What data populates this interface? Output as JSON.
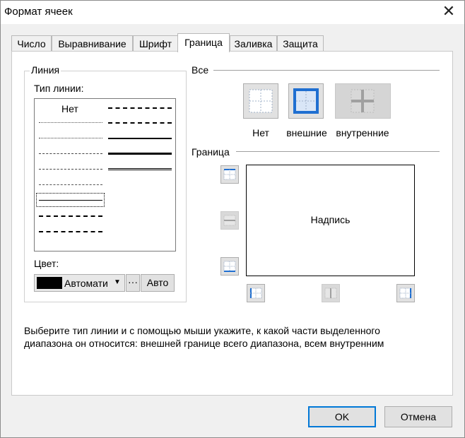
{
  "window": {
    "title": "Формат ячеек"
  },
  "tabs": [
    {
      "label": "Число"
    },
    {
      "label": "Выравнивание"
    },
    {
      "label": "Шрифт"
    },
    {
      "label": "Граница",
      "active": true
    },
    {
      "label": "Заливка"
    },
    {
      "label": "Защита"
    }
  ],
  "line_group": {
    "title": "Линия",
    "type_label": "Тип линии:",
    "none_label": "Нет",
    "color_label": "Цвет:",
    "color_value": "Автомати",
    "color_swatch": "#000000",
    "more_button": "···",
    "auto_button": "Авто"
  },
  "presets": {
    "title": "Все",
    "items": [
      {
        "label": "Нет"
      },
      {
        "label": "внешние"
      },
      {
        "label": "внутренние"
      }
    ]
  },
  "border": {
    "title": "Граница",
    "preview_text": "Надпись"
  },
  "help_text": [
    "Выберите тип линии и с помощью мыши укажите, к какой части выделенного",
    "диапазона он относится: внешней границе всего диапазона, всем внутренним"
  ],
  "footer": {
    "ok": "OK",
    "cancel": "Отмена"
  },
  "colors": {
    "accent": "#0078d7",
    "preview_icon_blue": "#1f6fd1"
  }
}
